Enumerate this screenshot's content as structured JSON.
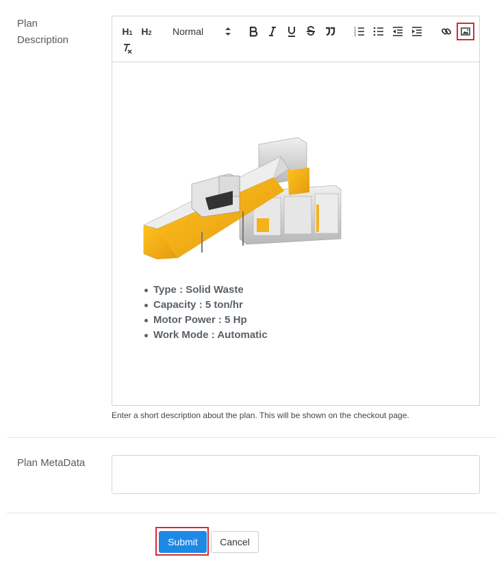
{
  "plan_description": {
    "label_line1": "Plan",
    "label_line2": "Description",
    "toolbar": {
      "h1_label": "H",
      "h1_sub": "1",
      "h2_label": "H",
      "h2_sub": "2",
      "format_select_value": "Normal",
      "icons": [
        "bold-icon",
        "italic-icon",
        "underline-icon",
        "strike-icon",
        "blockquote-icon",
        "ordered-list-icon",
        "bullet-list-icon",
        "outdent-icon",
        "indent-icon",
        "link-icon",
        "image-icon",
        "clear-format-icon"
      ]
    },
    "content_bullets": [
      "Type : Solid Waste",
      "Capacity : 5 ton/hr",
      "Motor Power : 5 Hp",
      "Work Mode : Automatic"
    ],
    "help_text": "Enter a short description about the plan. This will be shown on the checkout page."
  },
  "plan_metadata": {
    "label": "Plan MetaData",
    "value": ""
  },
  "actions": {
    "submit_label": "Submit",
    "cancel_label": "Cancel"
  },
  "colors": {
    "accent": "#1e88e5",
    "highlight": "#d9292c",
    "machine_yellow": "#f5b21a"
  }
}
